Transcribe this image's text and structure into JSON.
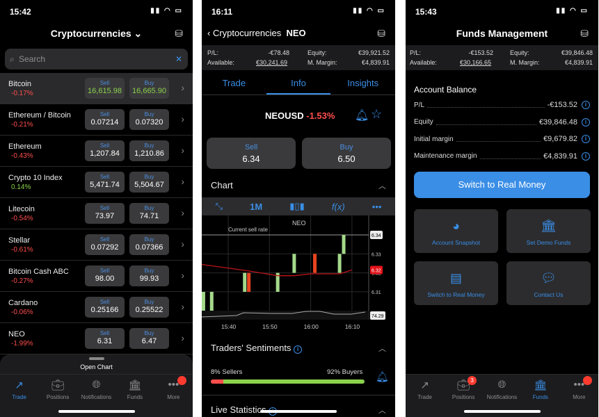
{
  "screen1": {
    "time": "15:42",
    "title": "Cryptocurrencies",
    "search_placeholder": "Search",
    "rows": [
      {
        "name": "Bitcoin",
        "change": "-0.17%",
        "sell": "16,615.98",
        "buy": "16,665.90"
      },
      {
        "name": "Ethereum / Bitcoin",
        "change": "-0.21%",
        "sell": "0.07214",
        "buy": "0.07320"
      },
      {
        "name": "Ethereum",
        "change": "-0.43%",
        "sell": "1,207.84",
        "buy": "1,210.86"
      },
      {
        "name": "Crypto 10 Index",
        "change": "0.14%",
        "sell": "5,471.74",
        "buy": "5,504.67"
      },
      {
        "name": "Litecoin",
        "change": "-0.54%",
        "sell": "73.97",
        "buy": "74.71"
      },
      {
        "name": "Stellar",
        "change": "-0.61%",
        "sell": "0.07292",
        "buy": "0.07366"
      },
      {
        "name": "Bitcoin Cash ABC",
        "change": "-0.27%",
        "sell": "98.00",
        "buy": "99.93"
      },
      {
        "name": "Cardano",
        "change": "-0.06%",
        "sell": "0.25166",
        "buy": "0.25522"
      },
      {
        "name": "NEO",
        "change": "-1.99%",
        "sell": "6.31",
        "buy": "6.47"
      }
    ],
    "sell_label": "Sell",
    "buy_label": "Buy",
    "open_chart": "Open Chart"
  },
  "tabs": [
    "Trade",
    "Positions",
    "Notifications",
    "Funds",
    "More"
  ],
  "screen2": {
    "time": "16:11",
    "back_label": "Cryptocurrencies",
    "instrument": "NEO",
    "pl_label": "P/L:",
    "pl": "-€78.48",
    "available_label": "Available:",
    "available": "€30,241.69",
    "equity_label": "Equity:",
    "equity": "€39,921.52",
    "margin_label": "M. Margin:",
    "margin": "€4,839.91",
    "tabs": [
      "Trade",
      "Info",
      "Insights"
    ],
    "active_tab": "Info",
    "symbol": "NEOUSD",
    "change": "-1.53%",
    "sell_label": "Sell",
    "sell": "6.34",
    "buy_label": "Buy",
    "buy": "6.50",
    "chart_title": "Chart",
    "timeframe": "1M",
    "sentiment_title": "Traders' Sentiments",
    "sellers": "8% Sellers",
    "buyers": "92% Buyers",
    "sellers_pct": 8,
    "live_stats": "Live Statistics"
  },
  "chart_data": {
    "type": "candlestick",
    "title": "NEO",
    "annotation": "Current sell rate",
    "x_ticks": [
      "15:40",
      "15:50",
      "16:00",
      "16:10"
    ],
    "y_ticks": [
      "6.31",
      "6.32",
      "6.33"
    ],
    "ylim": [
      6.3,
      6.345
    ],
    "current_sell": "6.34",
    "ma_label": "6.32",
    "indicator_value": "74.29",
    "candles": [
      {
        "t": "15:34",
        "o": 6.3,
        "c": 6.31
      },
      {
        "t": "15:36",
        "o": 6.3,
        "c": 6.31
      },
      {
        "t": "15:44",
        "o": 6.31,
        "c": 6.32
      },
      {
        "t": "15:45",
        "o": 6.32,
        "c": 6.31
      },
      {
        "t": "15:52",
        "o": 6.31,
        "c": 6.32
      },
      {
        "t": "15:56",
        "o": 6.32,
        "c": 6.33
      },
      {
        "t": "16:01",
        "o": 6.33,
        "c": 6.32
      },
      {
        "t": "16:07",
        "o": 6.32,
        "c": 6.33
      },
      {
        "t": "16:08",
        "o": 6.33,
        "c": 6.34
      }
    ],
    "ma": [
      {
        "t": "15:30",
        "v": 6.3255
      },
      {
        "t": "15:40",
        "v": 6.3225
      },
      {
        "t": "15:45",
        "v": 6.321
      },
      {
        "t": "15:52",
        "v": 6.3185
      },
      {
        "t": "15:56",
        "v": 6.3185
      },
      {
        "t": "16:00",
        "v": 6.3195
      },
      {
        "t": "16:07",
        "v": 6.3195
      },
      {
        "t": "16:10",
        "v": 6.3215
      }
    ],
    "colors": {
      "up": "#a4d98a",
      "down": "#e8441f",
      "ma": "#c0141b"
    }
  },
  "screen3": {
    "time": "15:43",
    "title": "Funds Management",
    "pl_label": "P/L:",
    "pl": "-€153.52",
    "available_label": "Available:",
    "available": "€30,166.65",
    "equity_label": "Equity:",
    "equity": "€39,846.48",
    "margin_label": "M. Margin:",
    "margin": "€4,839.91",
    "balance_title": "Account Balance",
    "balance": [
      {
        "label": "P/L",
        "value": "-€153.52"
      },
      {
        "label": "Equity",
        "value": "€39,846.48"
      },
      {
        "label": "Initial margin",
        "value": "€9,679.82"
      },
      {
        "label": "Maintenance margin",
        "value": "€4,839.91"
      }
    ],
    "switch_button": "Switch to Real Money",
    "tiles": [
      "Account Snapshot",
      "Set Demo Funds",
      "Switch to Real Money",
      "Contact Us"
    ],
    "positions_badge": "3"
  },
  "accent": "#3a8ee6"
}
